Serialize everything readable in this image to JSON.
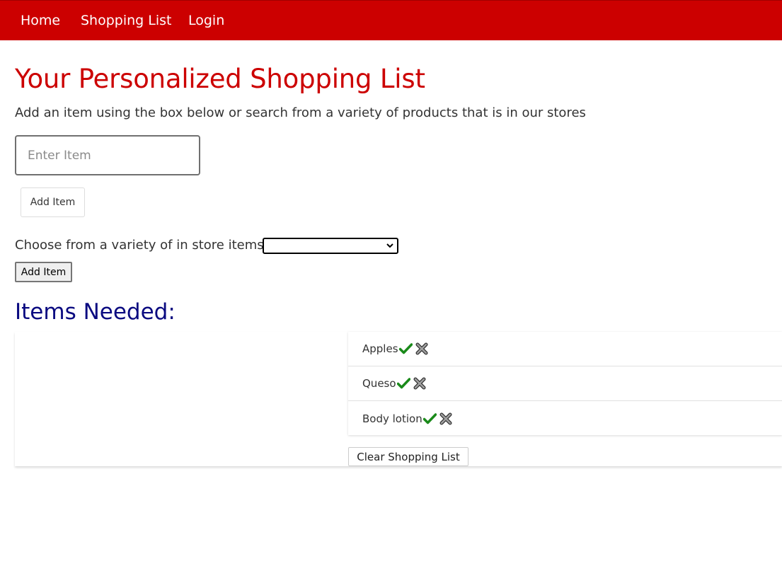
{
  "nav": {
    "items": [
      {
        "label": "Home"
      },
      {
        "label": "Shopping List"
      },
      {
        "label": "Login"
      }
    ]
  },
  "page": {
    "title": "Your Personalized Shopping List",
    "subtitle": "Add an item using the box below or search from a variety of products that is in our stores"
  },
  "add_form": {
    "input_placeholder": "Enter Item",
    "input_value": "",
    "add_label": "Add Item"
  },
  "store_form": {
    "choose_label": "Choose from a variety of in store items:",
    "selected": "",
    "add_label": "Add Item"
  },
  "list": {
    "heading": "Items Needed:",
    "items": [
      {
        "name": "Apples"
      },
      {
        "name": "Queso"
      },
      {
        "name": "Body lotion"
      }
    ],
    "clear_label": "Clear Shopping List"
  },
  "colors": {
    "nav_bg": "#cc0000",
    "title": "#cc0000",
    "heading": "#0a0a80",
    "check": "#1a8a1a"
  }
}
